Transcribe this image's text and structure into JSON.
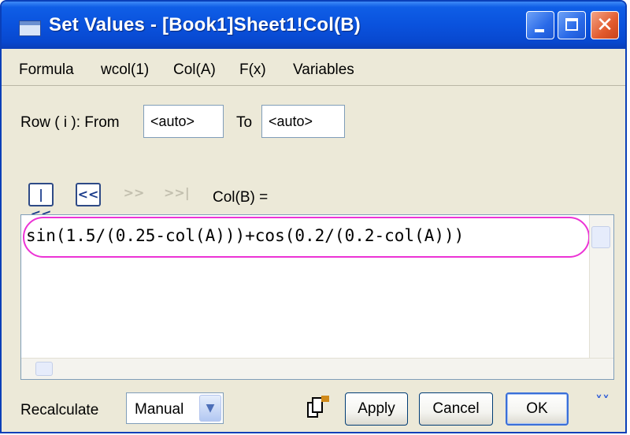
{
  "window": {
    "title": "Set Values - [Book1]Sheet1!Col(B)",
    "title_bar_color": "#0a52dd",
    "close_button_color": "#e25a2d"
  },
  "titlebar_buttons": {
    "minimize_icon": "minimize-icon",
    "maximize_icon": "maximize-icon",
    "close_symbol": "✕"
  },
  "menu": {
    "items": [
      "Formula",
      "wcol(1)",
      "Col(A)",
      "F(x)",
      "Variables"
    ]
  },
  "row_range": {
    "label": "Row ( i ):  From",
    "from_value": "<auto>",
    "to_label": "To",
    "to_value": "<auto>"
  },
  "navigation": {
    "first_label": "|<<",
    "prev_label": "<<",
    "next_label": ">>",
    "last_label": ">>|",
    "column_label": "Col(B) ="
  },
  "editor": {
    "formula": "sin(1.5/(0.25-col(A)))+cos(0.2/(0.2-col(A)))",
    "highlight_color": "#ec33d5"
  },
  "footer": {
    "recalculate_label": "Recalculate",
    "recalculate_value": "Manual",
    "dropdown_arrow": "▼",
    "apply_label": "Apply",
    "cancel_label": "Cancel",
    "ok_label": "OK",
    "expand_symbol": "˅˅"
  }
}
